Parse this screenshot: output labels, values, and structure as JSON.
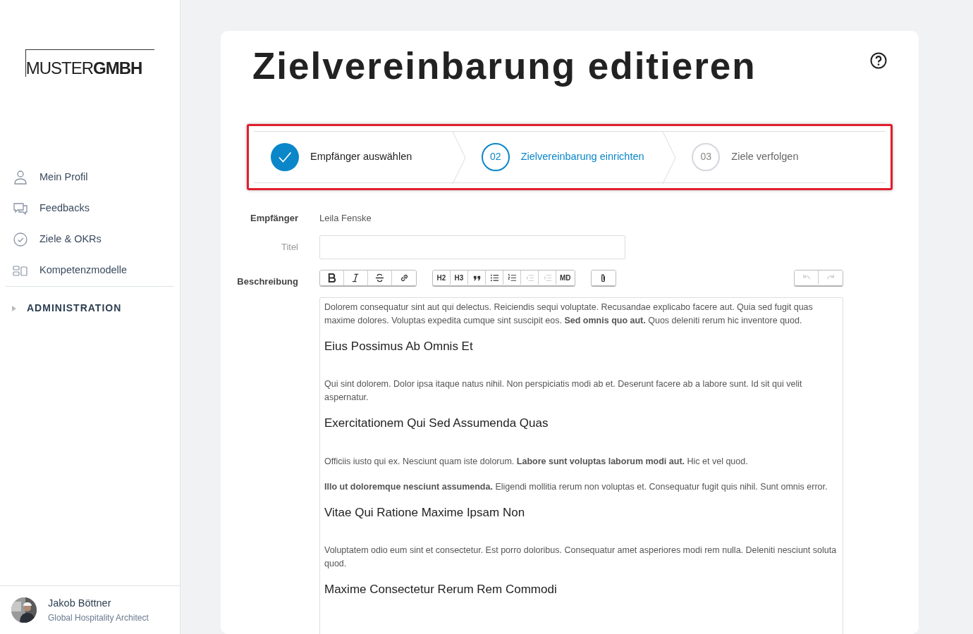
{
  "logo": {
    "text": "MUSTER**GMBH**"
  },
  "sidebar": {
    "items": [
      {
        "kind": "profile",
        "label": "Mein Profil"
      },
      {
        "kind": "feedback",
        "label": "Feedbacks"
      },
      {
        "kind": "goals",
        "label": "Ziele & OKRs"
      },
      {
        "kind": "models",
        "label": "Kompetenzmodelle"
      }
    ],
    "section": {
      "label": "ADMINISTRATION",
      "expanded": false
    },
    "user": {
      "name": "Jakob Böttner",
      "role": "Global Hospitality Architect"
    }
  },
  "page": {
    "title": "Zielvereinbarung editieren"
  },
  "stepper": {
    "highlighted": true,
    "steps": [
      {
        "label": "Empfänger auswählen",
        "done": true,
        "selected": false
      },
      {
        "number": "02",
        "label": "Zielvereinbarung einrichten",
        "done": false,
        "selected": true
      },
      {
        "number": "03",
        "label": "Ziele verfolgen",
        "done": false,
        "selected": false
      }
    ]
  },
  "form": {
    "recipient": {
      "label": "Empfänger",
      "value": "Leila Fenske"
    },
    "title": {
      "label": "Titel"
    },
    "description": {
      "label": "Beschreibung"
    }
  },
  "toolbar": [
    {
      "buttons": [
        {
          "kind": "bold",
          "disabled": false
        },
        {
          "kind": "italic",
          "disabled": false
        },
        {
          "kind": "strike",
          "disabled": false
        },
        {
          "kind": "link",
          "disabled": false
        }
      ]
    },
    {
      "buttons": [
        {
          "kind": "text",
          "label": "H2",
          "disabled": false
        },
        {
          "kind": "text",
          "label": "H3",
          "disabled": false
        },
        {
          "kind": "quote",
          "disabled": false
        },
        {
          "kind": "bullets",
          "disabled": false
        },
        {
          "kind": "numbers",
          "disabled": false
        },
        {
          "kind": "outdent",
          "disabled": true
        },
        {
          "kind": "indent",
          "disabled": true
        },
        {
          "kind": "text",
          "label": "MD",
          "disabled": false
        }
      ]
    },
    {
      "buttons": [
        {
          "kind": "attach",
          "disabled": false
        }
      ]
    },
    {
      "buttons": [
        {
          "kind": "undo",
          "disabled": true
        },
        {
          "kind": "redo",
          "disabled": true
        }
      ]
    }
  ],
  "editor": [
    {
      "kind": "paragraph",
      "text": "Dolorem consequatur sint aut qui delectus. Reiciendis sequi voluptate. Recusandae explicabo facere aut. Quia sed fugit quas maxime dolores. Voluptas expedita cumque sint suscipit eos. **Sed omnis quo aut.** Quos deleniti rerum hic inventore quod."
    },
    {
      "kind": "heading",
      "text": "Eius Possimus Ab Omnis Et"
    },
    {
      "kind": "paragraph",
      "text": "Qui sint dolorem. Dolor ipsa itaque natus nihil. Non perspiciatis modi ab et. Deserunt facere ab a labore sunt. Id sit qui velit aspernatur."
    },
    {
      "kind": "heading",
      "text": "Exercitationem Qui Sed Assumenda Quas"
    },
    {
      "kind": "paragraph",
      "text": "Officiis iusto qui ex. Nesciunt quam iste dolorum. **Labore sunt voluptas laborum modi aut.** Hic et vel quod."
    },
    {
      "kind": "paragraph",
      "text": "**Illo ut doloremque nesciunt assumenda.** Eligendi mollitia rerum non voluptas et. Consequatur fugit quis nihil. Sunt omnis error."
    },
    {
      "kind": "heading",
      "text": "Vitae Qui Ratione Maxime Ipsam Non"
    },
    {
      "kind": "paragraph",
      "text": "Voluptatem odio eum sint et consectetur. Est porro doloribus. Consequatur amet asperiores modi rem nulla. Deleniti nesciunt soluta quod."
    },
    {
      "kind": "heading",
      "text": "Maxime Consectetur Rerum Rem Commodi"
    }
  ]
}
